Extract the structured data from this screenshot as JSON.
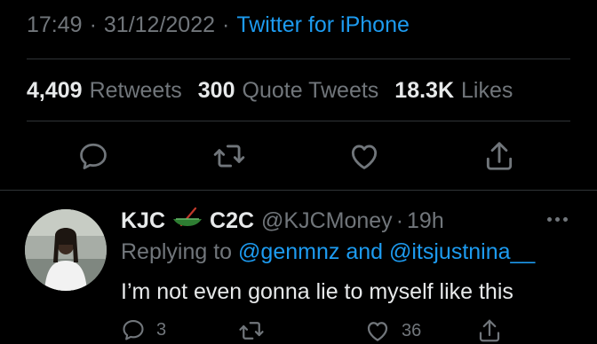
{
  "tweet_meta": {
    "time": "17:49",
    "date": "31/12/2022",
    "source": "Twitter for iPhone",
    "dot": "·"
  },
  "stats": {
    "retweets_count": "4,409",
    "retweets_label": "Retweets",
    "quotes_count": "300",
    "quotes_label": "Quote Tweets",
    "likes_count": "18.3K",
    "likes_label": "Likes"
  },
  "actions": [
    "reply-icon",
    "retweet-icon",
    "like-icon",
    "share-icon"
  ],
  "reply": {
    "name_part1": "KJC",
    "name_part2": "C2C",
    "handle": "@KJCMoney",
    "time": "19h",
    "dot": "·",
    "replying_label": "Replying to",
    "replying_to_1": "@genmnz",
    "and_label": "and",
    "replying_to_2": "@itsjustnina__",
    "text": "I’m not even gonna lie to myself like this",
    "reply_count": "3",
    "like_count": "36"
  },
  "colors": {
    "background": "#000000",
    "text_primary": "#e7e9ea",
    "text_secondary": "#71767b",
    "link": "#1d9bf0",
    "divider": "#2f3336"
  }
}
